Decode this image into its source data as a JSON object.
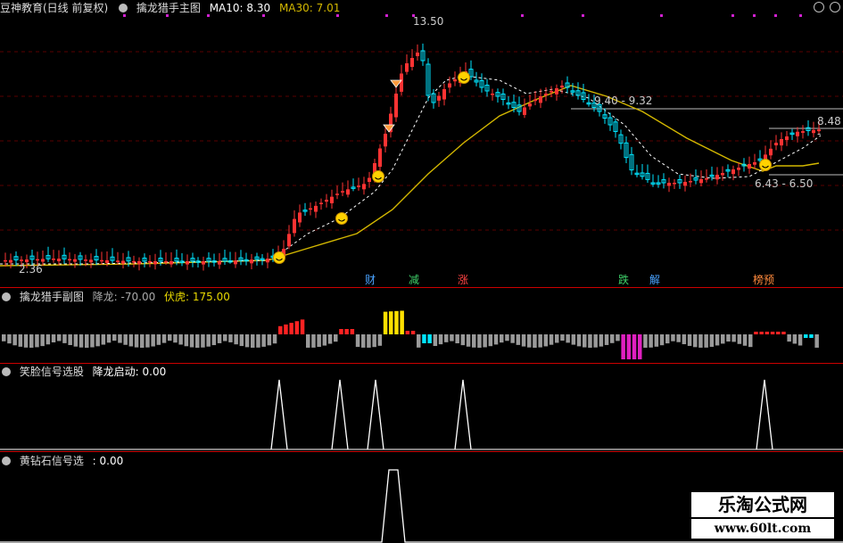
{
  "main": {
    "app_title": "豆神教育(日线 前复权)",
    "indicator": "擒龙猎手主图",
    "ma10_label": "MA10: 8.30",
    "ma30_label": "MA30: 7.01",
    "high_price": "13.50",
    "low_price": "2.36",
    "resistance": "9.40 - 9.32",
    "right_price": "8.48 -",
    "support": "6.43 - 6.50",
    "tags": [
      "财",
      "减",
      "涨",
      "跌",
      "解",
      "榜预"
    ]
  },
  "sub1": {
    "name": "擒龙猎手副图",
    "dragon_label": "降龙: -70.00",
    "tiger_label": "伏虎: 175.00"
  },
  "sub2": {
    "name": "笑脸信号选股",
    "signal_label": "降龙启动: 0.00"
  },
  "sub3": {
    "name": "黄钻石信号选",
    "signal_label": ": 0.00"
  },
  "watermark": {
    "name": "乐淘公式网",
    "url": "www.60lt.com"
  },
  "colors": {
    "up": "#ff3333",
    "down": "#00e5ff",
    "ma30": "#d4b800",
    "bg": "#000000",
    "sep": "#cc0000"
  },
  "icons": [
    "settings-icon",
    "smile-icon",
    "diamond-icon",
    "window-circle-icon"
  ]
}
